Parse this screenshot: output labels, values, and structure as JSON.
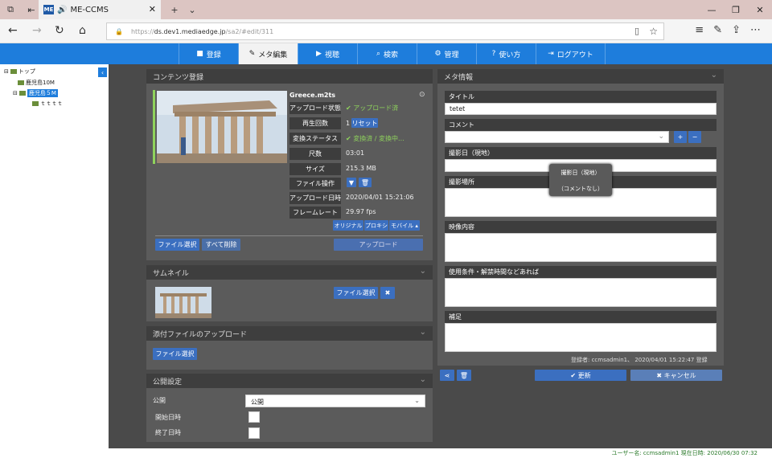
{
  "browser": {
    "tab_title": "ME-CCMS",
    "tab_logo": "ME",
    "url_prefix": "https://",
    "url_host": "ds.dev1.mediaedge.jp",
    "url_path": "/sa2/#edit/311"
  },
  "menu": {
    "items": [
      "登録",
      "メタ編集",
      "視聴",
      "検索",
      "管理",
      "使い方",
      "ログアウト"
    ]
  },
  "tree": {
    "root": "トップ",
    "items": [
      "鹿児島10M",
      "鹿児島５M",
      "ｔｔｔｔ"
    ]
  },
  "content": {
    "title": "コンテンツ登録",
    "filename": "Greece.m2ts",
    "rows": [
      {
        "label": "アップロード状態",
        "value": "✔ アップロード済"
      },
      {
        "label": "再生回数",
        "value": "1"
      },
      {
        "label": "変換ステータス",
        "value": "✔ 変換済 / 変換中..."
      },
      {
        "label": "尺数",
        "value": "03:01"
      },
      {
        "label": "サイズ",
        "value": "215.3 MB"
      },
      {
        "label": "ファイル操作",
        "value": ""
      },
      {
        "label": "アップロード日時",
        "value": "2020/04/01 15:21:06"
      },
      {
        "label": "フレームレート",
        "value": "29.97 fps"
      }
    ],
    "reset": "リセット",
    "original": "オリジナル",
    "proxy": "プロキシ",
    "mobile": "モバイル ▴",
    "file_select": "ファイル選択",
    "delete_all": "すべて削除",
    "upload": "アップロード"
  },
  "thumbnail": {
    "title": "サムネイル",
    "file_select": "ファイル選択"
  },
  "attach": {
    "title": "添付ファイルのアップロード",
    "file_select": "ファイル選択"
  },
  "publish": {
    "title": "公開設定",
    "public_label": "公開",
    "public_value": "公開",
    "start_label": "開始日時",
    "end_label": "終了日時"
  },
  "meta": {
    "title": "メタ情報",
    "title_label": "タイトル",
    "title_value": "tetet",
    "comment_label": "コメント",
    "date_label": "撮影日（現地）",
    "place_label": "撮影場所",
    "content_label": "映像内容",
    "terms_label": "使用条件・解禁時間などあれば",
    "note_label": "補足",
    "footer": "登録者: ccmsadmin1、 2020/04/01 15:22:47 登録",
    "update": "✔ 更新",
    "cancel": "✖ キャンセル"
  },
  "tooltip": {
    "title": "撮影日（現地）",
    "body": "（コメントなし）"
  },
  "status": {
    "text": "ユーザー名: ccmsadmin1  現在日時: 2020/06/30 07:32"
  },
  "colors": {
    "accent": "#1e7ddc",
    "button": "#3b6fc0",
    "panel": "#5b5b5b"
  }
}
